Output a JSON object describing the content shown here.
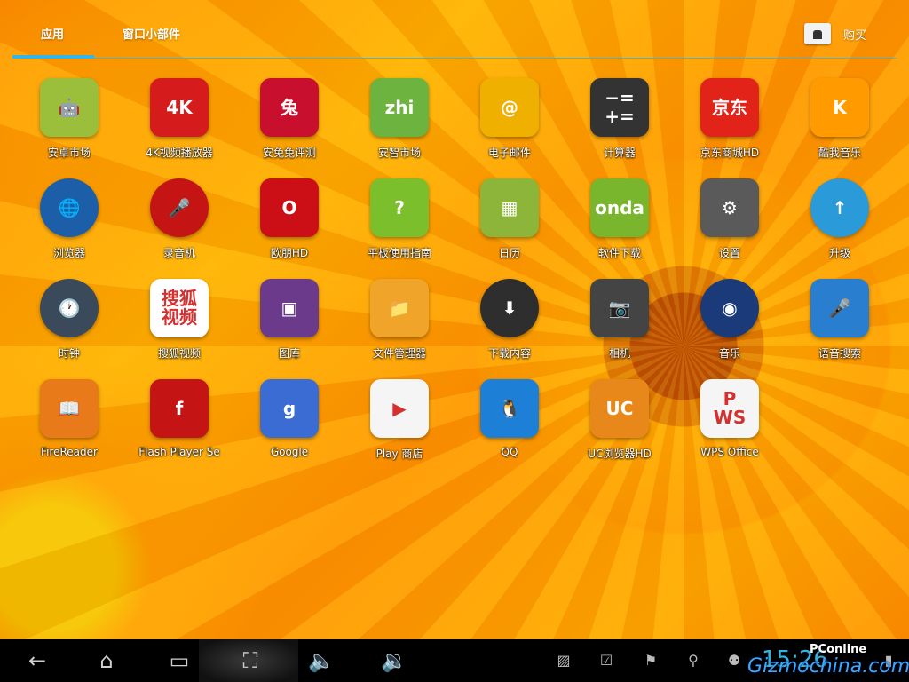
{
  "tabs": {
    "apps": "应用",
    "widgets": "窗口小部件"
  },
  "store": {
    "label": "购买"
  },
  "apps": [
    {
      "label": "安卓市场",
      "icon": "android-market-icon",
      "glyph": "🤖",
      "color": "#9bbf3a"
    },
    {
      "label": "4K视频播放器",
      "icon": "4k-video-player-icon",
      "glyph": "4K",
      "color": "#d51b1b"
    },
    {
      "label": "安兔兔评测",
      "icon": "antutu-icon",
      "glyph": "兔",
      "color": "#c8102e"
    },
    {
      "label": "安智市场",
      "icon": "anzhi-market-icon",
      "glyph": "zhi",
      "color": "#6db33f"
    },
    {
      "label": "电子邮件",
      "icon": "email-icon",
      "glyph": "@",
      "color": "#f0b000"
    },
    {
      "label": "计算器",
      "icon": "calculator-icon",
      "glyph": "−=\n+=",
      "color": "#333333"
    },
    {
      "label": "京东商城HD",
      "icon": "jd-mall-icon",
      "glyph": "京东",
      "color": "#e2231a"
    },
    {
      "label": "酷我音乐",
      "icon": "kuwo-music-icon",
      "glyph": "K",
      "color": "#ff9a00"
    },
    {
      "label": "浏览器",
      "icon": "browser-globe-icon",
      "glyph": "🌐",
      "color": "#1c5fa8"
    },
    {
      "label": "录音机",
      "icon": "sound-recorder-icon",
      "glyph": "🎤",
      "color": "#c41414"
    },
    {
      "label": "欧朋HD",
      "icon": "opera-icon",
      "glyph": "O",
      "color": "#cc0f16"
    },
    {
      "label": "平板使用指南",
      "icon": "tablet-guide-icon",
      "glyph": "?",
      "color": "#7cbf2c"
    },
    {
      "label": "日历",
      "icon": "calendar-icon",
      "glyph": "▦",
      "color": "#8db53a"
    },
    {
      "label": "软件下载",
      "icon": "onda-software-download-icon",
      "glyph": "onda",
      "color": "#7ab52e"
    },
    {
      "label": "设置",
      "icon": "settings-gear-icon",
      "glyph": "⚙",
      "color": "#5a5a5a"
    },
    {
      "label": "升级",
      "icon": "upgrade-arrow-icon",
      "glyph": "↑",
      "color": "#2a9ad8"
    },
    {
      "label": "时钟",
      "icon": "clock-icon",
      "glyph": "🕐",
      "color": "#3a4a5a"
    },
    {
      "label": "搜狐视频",
      "icon": "sohu-video-icon",
      "glyph": "搜狐\n视频",
      "color": "#ffffff"
    },
    {
      "label": "图库",
      "icon": "gallery-icon",
      "glyph": "▣",
      "color": "#6b3a8a"
    },
    {
      "label": "文件管理器",
      "icon": "file-manager-icon",
      "glyph": "📁",
      "color": "#f0a52a"
    },
    {
      "label": "下载内容",
      "icon": "downloads-icon",
      "glyph": "⬇",
      "color": "#2e2e2e"
    },
    {
      "label": "相机",
      "icon": "camera-icon",
      "glyph": "📷",
      "color": "#444444"
    },
    {
      "label": "音乐",
      "icon": "music-speaker-icon",
      "glyph": "◉",
      "color": "#1a3a7a"
    },
    {
      "label": "语音搜索",
      "icon": "voice-search-icon",
      "glyph": "🎤",
      "color": "#2a7ed0"
    },
    {
      "label": "FireReader",
      "icon": "firereader-icon",
      "glyph": "📖",
      "color": "#e87a1a"
    },
    {
      "label": "Flash Player Se",
      "icon": "flash-player-icon",
      "glyph": "f",
      "color": "#c41414"
    },
    {
      "label": "Google",
      "icon": "google-search-icon",
      "glyph": "g",
      "color": "#3a6cd4"
    },
    {
      "label": "Play 商店",
      "icon": "play-store-icon",
      "glyph": "▶",
      "color": "#f5f5f5"
    },
    {
      "label": "QQ",
      "icon": "qq-penguin-icon",
      "glyph": "🐧",
      "color": "#1e7fd6"
    },
    {
      "label": "UC浏览器HD",
      "icon": "uc-browser-icon",
      "glyph": "UC",
      "color": "#e8871a"
    },
    {
      "label": "WPS Office",
      "icon": "wps-office-icon",
      "glyph": "P\nWS",
      "color": "#f5f5f5"
    }
  ],
  "navbar": {
    "back": "back-icon",
    "home": "home-icon",
    "recents": "recent-apps-icon",
    "screenshot": "screenshot-icon",
    "vol_down": "volume-down-icon",
    "vol_up": "volume-up-icon"
  },
  "status": {
    "time": "15:26"
  },
  "watermark": {
    "brand": "PConline",
    "site": "Gizmochina.com"
  }
}
